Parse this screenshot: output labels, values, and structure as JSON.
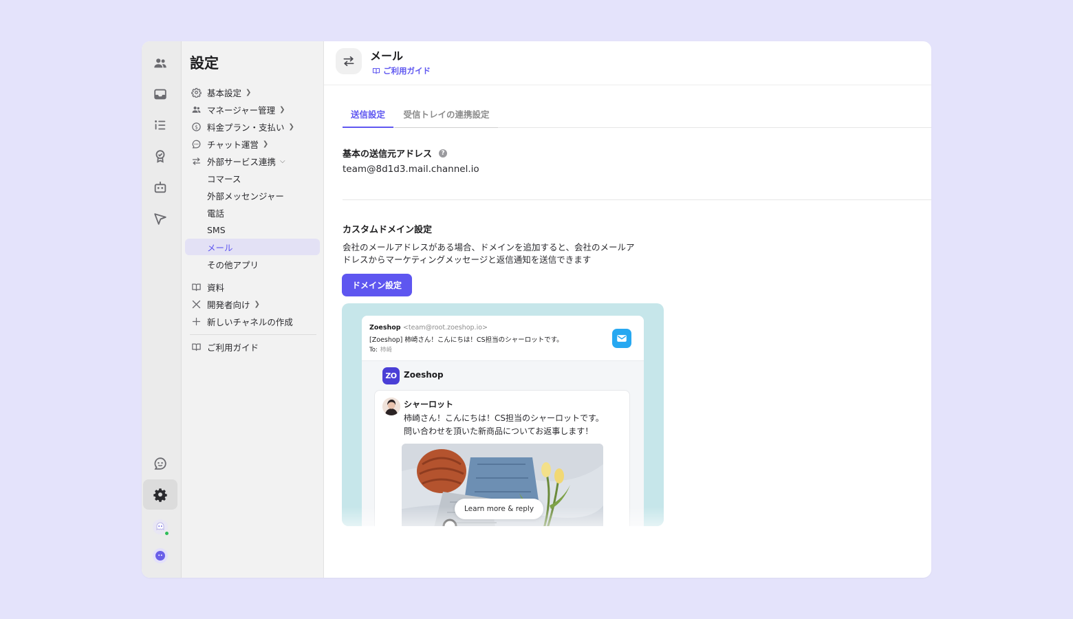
{
  "colors": {
    "accent": "#5e56f0",
    "page_bg": "#e4e3fb",
    "mail_icon": "#27a8f1",
    "brand": "#4a3fd6",
    "online": "#2ebd59"
  },
  "rail": {
    "items": [
      {
        "icon": "people-icon"
      },
      {
        "icon": "inbox-icon"
      },
      {
        "icon": "list-icon"
      },
      {
        "icon": "badge-icon"
      },
      {
        "icon": "bot-icon"
      },
      {
        "icon": "send-icon"
      },
      {
        "icon": "support-icon"
      },
      {
        "icon": "gear-icon",
        "active": true
      }
    ]
  },
  "sidebar": {
    "title": "設定",
    "items": [
      {
        "label": "基本設定",
        "icon": "gear-icon",
        "chevron": "right"
      },
      {
        "label": "マネージャー管理",
        "icon": "people-icon",
        "chevron": "right"
      },
      {
        "label": "料金プラン・支払い",
        "icon": "coin-icon",
        "chevron": "right"
      },
      {
        "label": "チャット運営",
        "icon": "chat-icon",
        "chevron": "right"
      },
      {
        "label": "外部サービス連携",
        "icon": "swap-icon",
        "chevron": "down"
      },
      {
        "label": "コマース"
      },
      {
        "label": "外部メッセンジャー"
      },
      {
        "label": "電話"
      },
      {
        "label": "SMS"
      },
      {
        "label": "メール",
        "active": true
      },
      {
        "label": "その他アプリ"
      },
      {
        "label": "資料",
        "icon": "book-icon"
      },
      {
        "label": "開発者向け",
        "icon": "tools-icon",
        "chevron": "right"
      },
      {
        "label": "新しいチャネルの作成",
        "icon": "plus-icon"
      },
      {
        "label": "ご利用ガイド",
        "icon": "book-icon"
      }
    ]
  },
  "header": {
    "title": "メール",
    "guide_label": "ご利用ガイド"
  },
  "tabs": [
    {
      "label": "送信設定",
      "active": true
    },
    {
      "label": "受信トレイの連携設定",
      "active": false
    }
  ],
  "sender": {
    "label": "基本の送信元アドレス",
    "help": "?",
    "address": "team@8d1d3.mail.channel.io"
  },
  "custom_domain": {
    "label": "カスタムドメイン設定",
    "description_line1": "会社のメールアドレスがある場合、ドメインを追加すると、会社のメールア",
    "description_line2": "ドレスからマーケティングメッセージと返信通知を送信できます",
    "button_label": "ドメイン設定"
  },
  "preview": {
    "from_name": "Zoeshop",
    "from_address": "<team@root.zoeshop.io>",
    "subject": "[Zoeshop] 柿崎さん！こんにちは！CS担当のシャーロットです。",
    "to_label": "To:",
    "to_name": "柿崎",
    "brand_logo": "ZO",
    "brand_name": "Zoeshop",
    "sender_name": "シャーロット",
    "message_line1": "柿崎さん！こんにちは！CS担当のシャーロットです。",
    "message_line2": "問い合わせを頂いた新商品についてお返事します！",
    "cta_label": "Learn more & reply"
  }
}
